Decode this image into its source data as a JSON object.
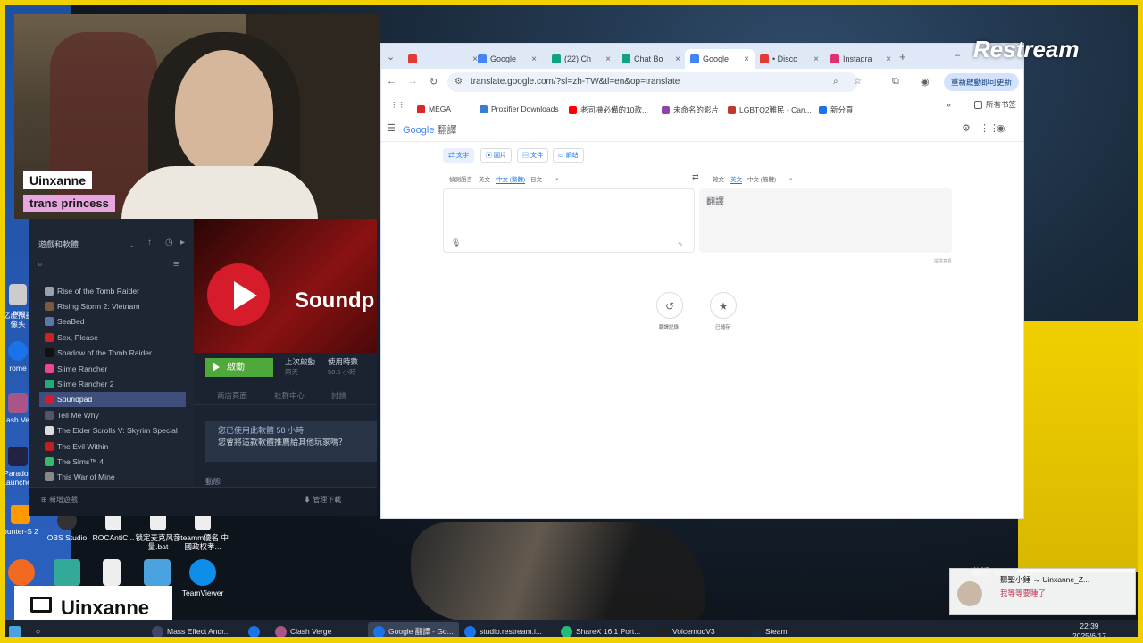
{
  "colors": {
    "frame": "#f0d000",
    "steam_bg": "#1b2230",
    "steam_play": "#4fa83a",
    "chrome_accent": "#1a73e8",
    "tab_strip": "#dfe8f7"
  },
  "webcam": {
    "name": "Uinxanne",
    "title": "trans princess"
  },
  "steam": {
    "filter": "遊戲和軟體",
    "games": [
      {
        "name": "Rise of the Tomb Raider",
        "color": "#9aa3ad"
      },
      {
        "name": "Rising Storm 2: Vietnam",
        "color": "#7a5a3a"
      },
      {
        "name": "SeaBed",
        "color": "#5a79a6"
      },
      {
        "name": "Sex, Please",
        "color": "#c22"
      },
      {
        "name": "Shadow of the Tomb Raider",
        "color": "#111"
      },
      {
        "name": "Slime Rancher",
        "color": "#e9488c"
      },
      {
        "name": "Slime Rancher 2",
        "color": "#2a7"
      },
      {
        "name": "Soundpad",
        "color": "#d61c2a"
      },
      {
        "name": "Tell Me Why",
        "color": "#556"
      },
      {
        "name": "The Elder Scrolls V: Skyrim Special",
        "color": "#ddd"
      },
      {
        "name": "The Evil Within",
        "color": "#b22"
      },
      {
        "name": "The Sims™ 4",
        "color": "#3b6"
      },
      {
        "name": "This War of Mine",
        "color": "#888"
      }
    ],
    "selected_index": 7,
    "hero_title": "Soundp",
    "play_label": "啟動",
    "last_played_label": "上次啟動",
    "last_played_value": "兩天",
    "playtime_label": "使用時數",
    "playtime_value": "58.6 小時",
    "tabs": [
      "商店頁面",
      "社群中心",
      "討論"
    ],
    "notice_line1": "您已使用此軟體 58 小時",
    "notice_line2": "您會將這款軟體推薦給其他玩家嗎？",
    "news_label": "動態",
    "add_game": "新增遊戲",
    "downloads": "管理下載"
  },
  "chrome": {
    "tabs": [
      {
        "label": "",
        "active": false,
        "color": "#e53935"
      },
      {
        "label": "Google",
        "active": false,
        "color": "#4285f4"
      },
      {
        "label": "(22) Ch",
        "active": false,
        "color": "#10a37f"
      },
      {
        "label": "Chat Bo",
        "active": false,
        "color": "#10a37f"
      },
      {
        "label": "Google",
        "active": true,
        "color": "#4285f4"
      },
      {
        "label": "• Disco",
        "active": false,
        "color": "#e53935"
      },
      {
        "label": "Instagra",
        "active": false,
        "color": "#e1306c"
      }
    ],
    "url": "translate.google.com/?sl=zh-TW&tl=en&op=translate",
    "update_button": "重新啟動即可更新",
    "bookmarks": [
      {
        "label": "MEGA",
        "color": "#d9272e"
      },
      {
        "label": "Proxifier Downloads",
        "color": "#3a7bd5"
      },
      {
        "label": "老司機必備的10款...",
        "color": "#ff0000"
      },
      {
        "label": "未命名的影片",
        "color": "#8e44ad"
      },
      {
        "label": "LGBTQ2難民 - Can...",
        "color": "#c0392b"
      },
      {
        "label": "新分頁",
        "color": "#1a73e8"
      }
    ],
    "all_bookmarks": "所有书签",
    "translate": {
      "brand_google": "Google",
      "brand_product": "翻譯",
      "modes": [
        "文字",
        "圖片",
        "文件",
        "網站"
      ],
      "source_langs": [
        "偵測語言",
        "英文",
        "中文 (繁體)",
        "日文"
      ],
      "target_langs": [
        "韓文",
        "英文",
        "中文 (簡體)"
      ],
      "output_placeholder": "翻譯",
      "feedback": "提供意見",
      "history_label": "翻譯記錄",
      "saved_label": "已儲存"
    }
  },
  "restream_logo": "Restream",
  "desktop_icons": [
    {
      "label": ".png",
      "color": "#ccc"
    },
    {
      "label": "亿虚拟摄像头",
      "color": "#2a6"
    },
    {
      "label": "rome",
      "color": "#1a73e8"
    },
    {
      "label": "ash Ve",
      "color": "#a58"
    },
    {
      "label": "Paradox Launcher",
      "color": "#224"
    },
    {
      "label": "ounter-S 2",
      "color": "#f90"
    },
    {
      "label": "OBS Studio",
      "color": "#333"
    },
    {
      "label": "ROCAntiC...",
      "color": "#eee"
    },
    {
      "label": "锁定麦克风音量.bat",
      "color": "#eee"
    },
    {
      "label": "steamm優名 中國政权孝...",
      "color": "#eee"
    }
  ],
  "desktop_icons_row2": [
    {
      "label": "",
      "color": "#f26a21"
    },
    {
      "label": "",
      "color": "#3a9"
    },
    {
      "label": "",
      "color": "#eee"
    },
    {
      "label": "",
      "color": "#4aa3df"
    },
    {
      "label": "TeamViewer",
      "color": "#0e8ee9"
    }
  ],
  "brand_name": "Uinxanne",
  "windows_activation": "激活 Windows",
  "notification": {
    "title": "聽聖小錘 → Uinxanne_Z...",
    "body": "我等等要睡了"
  },
  "taskbar": {
    "items": [
      {
        "label": "Mass Effect Andr...",
        "color": "#446",
        "active": false
      },
      {
        "label": "",
        "color": "#1a73e8",
        "active": false
      },
      {
        "label": "Clash Verge",
        "color": "#a58",
        "active": false
      },
      {
        "label": "Google 翻譯 - Go...",
        "color": "#1a73e8",
        "active": true
      },
      {
        "label": "studio.restream.i...",
        "color": "#1a73e8",
        "active": false
      },
      {
        "label": "ShareX 16.1 Port...",
        "color": "#2b7",
        "active": false
      },
      {
        "label": "VoicemodV3",
        "color": "#222",
        "active": false
      },
      {
        "label": "Steam",
        "color": "#1b2838",
        "active": false
      }
    ],
    "time": "22:39",
    "date": "2025/6/17"
  }
}
